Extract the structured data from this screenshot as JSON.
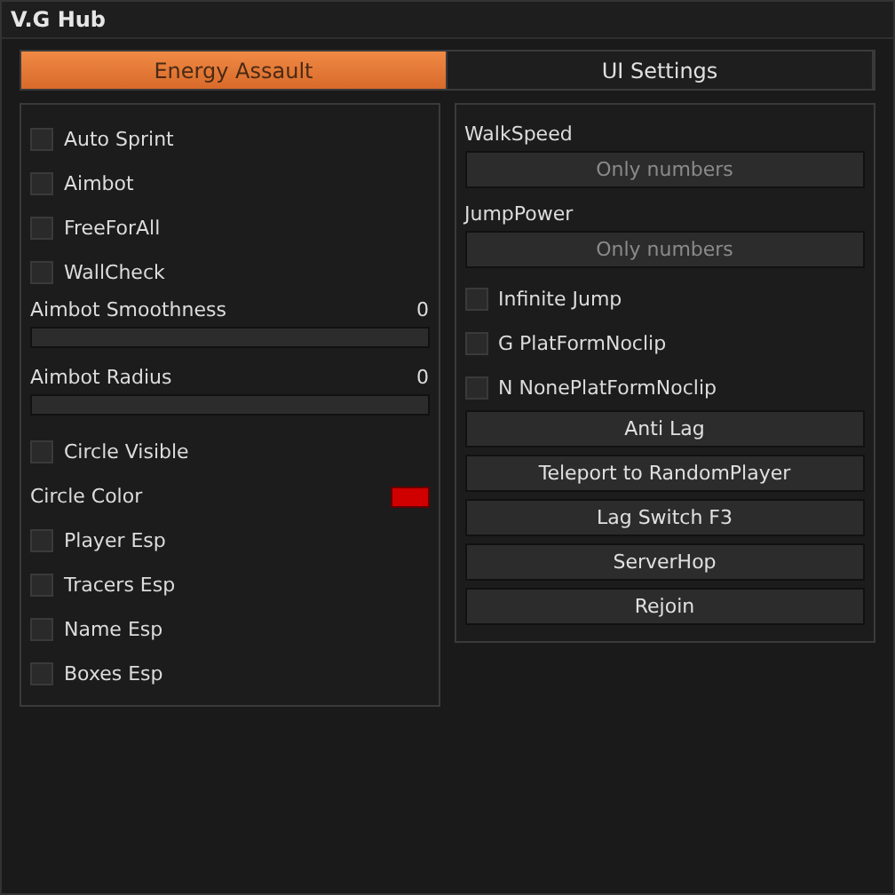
{
  "window": {
    "title": "V.G Hub"
  },
  "tabs": [
    {
      "label": "Energy Assault",
      "selected": true
    },
    {
      "label": "UI Settings",
      "selected": false
    }
  ],
  "left_panel": [
    {
      "kind": "checkbox",
      "label": "Auto Sprint",
      "checked": false
    },
    {
      "kind": "checkbox",
      "label": "Aimbot",
      "checked": false
    },
    {
      "kind": "checkbox",
      "label": "FreeForAll",
      "checked": false
    },
    {
      "kind": "checkbox",
      "label": "WallCheck",
      "checked": false
    },
    {
      "kind": "slider",
      "label": "Aimbot Smoothness",
      "reading": "0"
    },
    {
      "kind": "slider",
      "label": "Aimbot Radius",
      "reading": "0"
    },
    {
      "kind": "checkbox",
      "label": "Circle Visible",
      "checked": false
    },
    {
      "kind": "color",
      "label": "Circle Color",
      "color": "#d00000"
    },
    {
      "kind": "checkbox",
      "label": "Player Esp",
      "checked": false
    },
    {
      "kind": "checkbox",
      "label": "Tracers Esp",
      "checked": false
    },
    {
      "kind": "checkbox",
      "label": "Name Esp",
      "checked": false
    },
    {
      "kind": "checkbox",
      "label": "Boxes Esp",
      "checked": false
    }
  ],
  "right_panel": [
    {
      "kind": "textbox",
      "label": "WalkSpeed",
      "placeholder": "Only numbers"
    },
    {
      "kind": "textbox",
      "label": "JumpPower",
      "placeholder": "Only numbers"
    },
    {
      "kind": "checkbox",
      "label": "Infinite Jump",
      "checked": false
    },
    {
      "kind": "checkbox",
      "label": "G PlatFormNoclip",
      "checked": false
    },
    {
      "kind": "checkbox",
      "label": "N NonePlatFormNoclip",
      "checked": false
    },
    {
      "kind": "button",
      "label": "Anti Lag"
    },
    {
      "kind": "button",
      "label": "Teleport to RandomPlayer"
    },
    {
      "kind": "button",
      "label": "Lag Switch F3"
    },
    {
      "kind": "button",
      "label": "ServerHop"
    },
    {
      "kind": "button",
      "label": "Rejoin"
    }
  ]
}
